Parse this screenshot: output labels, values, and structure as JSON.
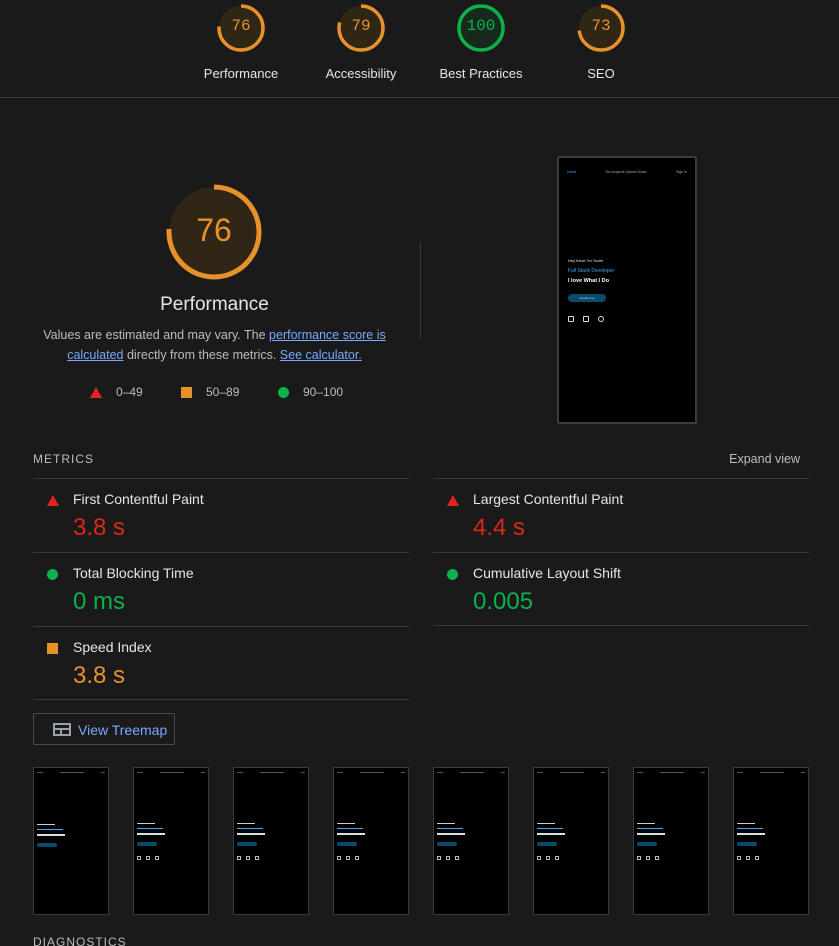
{
  "top_scores": [
    {
      "label": "Performance",
      "score": "76",
      "color": "#e8912a",
      "fraction": 0.76
    },
    {
      "label": "Accessibility",
      "score": "79",
      "color": "#e8912a",
      "fraction": 0.79
    },
    {
      "label": "Best Practices",
      "score": "100",
      "color": "#0cb14a",
      "fraction": 1.0
    },
    {
      "label": "SEO",
      "score": "73",
      "color": "#e8912a",
      "fraction": 0.73
    }
  ],
  "performance": {
    "score": "76",
    "fraction": 0.76,
    "title": "Performance",
    "desc_pre": "Values are estimated and may vary. The ",
    "desc_link1": "performance score is calculated",
    "desc_mid": " directly from these metrics. ",
    "desc_link2": "See calculator."
  },
  "legend": [
    {
      "shape": "triangle",
      "range": "0–49",
      "color": "#e0261c"
    },
    {
      "shape": "square",
      "range": "50–89",
      "color": "#e8912a"
    },
    {
      "shape": "circle",
      "range": "90–100",
      "color": "#0cb14a"
    }
  ],
  "preview": {
    "logo": "Home",
    "nav_links": [
      "Our projects",
      "Games",
      "Music"
    ],
    "nav_right": "Sign In",
    "greeting": "Hey there I'm Yuder",
    "role": "Full Stack Developer",
    "tagline": "I love What I Do",
    "cta": "Contact me"
  },
  "metrics": {
    "heading": "METRICS",
    "expand_label": "Expand view",
    "items": [
      {
        "name": "First Contentful Paint",
        "value": "3.8 s",
        "status": "red"
      },
      {
        "name": "Largest Contentful Paint",
        "value": "4.4 s",
        "status": "red"
      },
      {
        "name": "Total Blocking Time",
        "value": "0 ms",
        "status": "green"
      },
      {
        "name": "Cumulative Layout Shift",
        "value": "0.005",
        "status": "green"
      },
      {
        "name": "Speed Index",
        "value": "3.8 s",
        "status": "orange"
      }
    ]
  },
  "treemap_label": "View Treemap",
  "diagnostics_heading": "DIAGNOSTICS",
  "colors": {
    "bg": "#1a1a1a",
    "orange": "#e8912a",
    "green": "#0cb14a",
    "red": "#e0261c",
    "link": "#78a9ff"
  }
}
